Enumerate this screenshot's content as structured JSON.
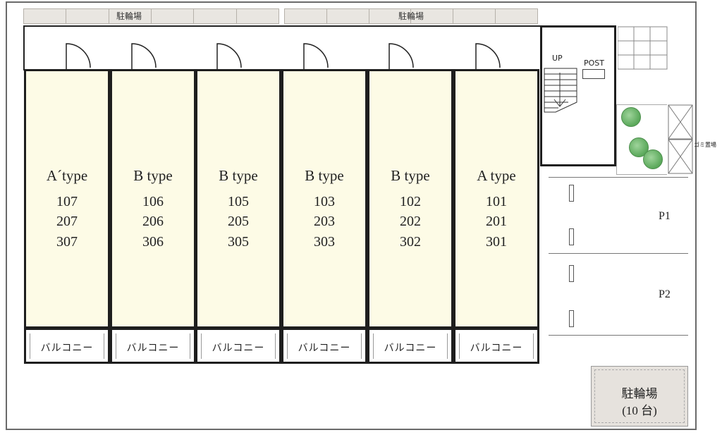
{
  "top_strips": [
    {
      "label": "駐輪場"
    },
    {
      "label": "駐輪場"
    }
  ],
  "units": [
    {
      "type": "A´type",
      "rooms": [
        "107",
        "207",
        "307"
      ]
    },
    {
      "type": "B type",
      "rooms": [
        "106",
        "206",
        "306"
      ]
    },
    {
      "type": "B type",
      "rooms": [
        "105",
        "205",
        "305"
      ]
    },
    {
      "type": "B type",
      "rooms": [
        "103",
        "203",
        "303"
      ]
    },
    {
      "type": "B type",
      "rooms": [
        "102",
        "202",
        "302"
      ]
    },
    {
      "type": "A type",
      "rooms": [
        "101",
        "201",
        "301"
      ]
    }
  ],
  "balconies": [
    "バルコニー",
    "バルコニー",
    "バルコニー",
    "バルコニー",
    "バルコニー",
    "バルコニー"
  ],
  "stair": {
    "up_label": "UP",
    "post_label": "POST"
  },
  "trash": {
    "label": "ゴミ置場"
  },
  "parking": [
    {
      "label": "P1"
    },
    {
      "label": "P2"
    }
  ],
  "bike_lot": {
    "label": "駐輪場",
    "capacity": "(10 台)"
  },
  "colors": {
    "unit_fill": "#fdfbe6",
    "strip_fill": "#e9e6e1",
    "wall": "#1e1e1e",
    "tree": "#5aa85a"
  }
}
